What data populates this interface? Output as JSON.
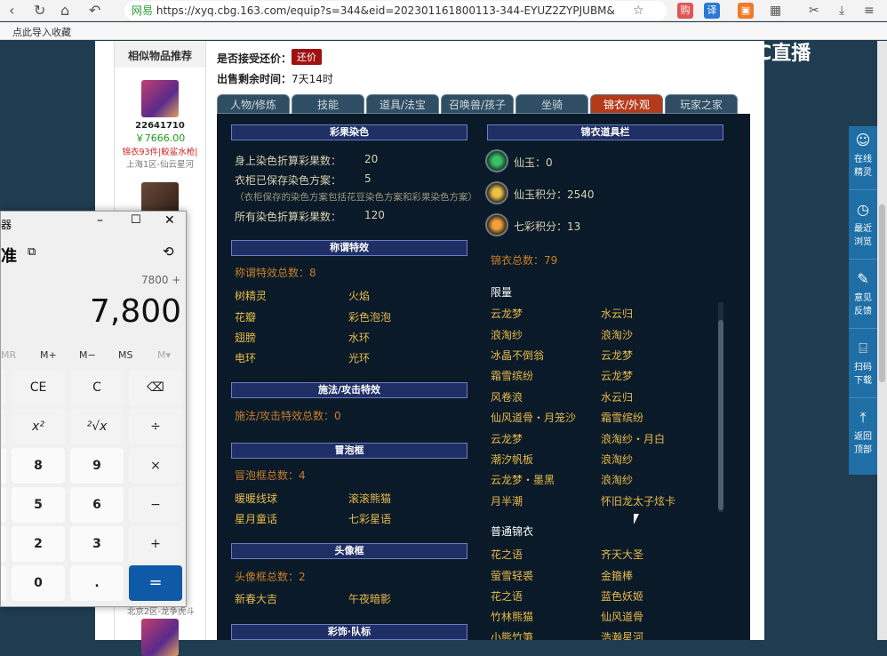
{
  "browser": {
    "security_label": "网易",
    "url": "https://xyq.cbg.163.com/equip?s=344&eid=202301161800113-344-EYUZ2ZYPJUBM&",
    "ext1": "购",
    "ext2": "译"
  },
  "bookmark_bar": {
    "import_label": "点此导入收藏"
  },
  "sidebar": {
    "title": "相似物品推荐",
    "items": [
      {
        "id": "22641710",
        "price": "￥7666.00",
        "tag": "锦衣93件|鲛鲨水枪|",
        "server": "上海1区-仙云星河"
      }
    ],
    "bottom_server": "北京2区-龙争虎斗"
  },
  "info": {
    "accept_label": "是否接受还价：",
    "accept_btn": "还价",
    "time_label": "出售剩余时间：",
    "time_value": "7天14时"
  },
  "tabs": [
    "人物/修炼",
    "技能",
    "道具/法宝",
    "召唤兽/孩子",
    "坐骑",
    "锦衣/外观",
    "玩家之家"
  ],
  "dye": {
    "title": "彩果染色",
    "row1_label": "身上染色折算彩果数：",
    "row1_value": "20",
    "row2_label": "衣柜已保存染色方案：",
    "row2_value": "5",
    "note": "（衣柜保存的染色方案包括花豆染色方案和彩果染色方案）",
    "row3_label": "所有染色折算彩果数：",
    "row3_value": "120"
  },
  "title_effect": {
    "title": "称谓特效",
    "total": "称谓特效总数：8",
    "items": [
      "树精灵",
      "火焰",
      "花瓣",
      "彩色泡泡",
      "翅膀",
      "水环",
      "电环",
      "光环"
    ]
  },
  "cast_effect": {
    "title": "施法/攻击特效",
    "total": "施法/攻击特效总数：0"
  },
  "bubble": {
    "title": "冒泡框",
    "total": "冒泡框总数：4",
    "items": [
      "暖暖线球",
      "滚滚熊猫",
      "星月童话",
      "七彩星语"
    ]
  },
  "avatar_frame": {
    "title": "头像框",
    "total": "头像框总数：2",
    "items": [
      "新春大吉",
      "午夜暗影"
    ]
  },
  "color_team": {
    "title": "彩饰·队标"
  },
  "wardrobe": {
    "title": "锦衣道具栏",
    "xianyu": "仙玉：0",
    "xianyu_points": "仙玉积分：2540",
    "qicai_points": "七彩积分：13",
    "total": "锦衣总数：79",
    "limited_title": "限量",
    "limited": [
      "云龙梦",
      "水云归",
      "浪淘纱",
      "浪淘沙",
      "冰晶不倒翁",
      "云龙梦",
      "霜雪缤纷",
      "云龙梦",
      "风卷浪",
      "水云归",
      "仙风道骨・月笼沙",
      "霜雪缤纷",
      "云龙梦",
      "浪淘纱・月白",
      "潮汐帆板",
      "浪淘纱",
      "云龙梦・墨黑",
      "浪淘纱",
      "月半潮",
      "怀旧龙太子炫卡"
    ],
    "common_title": "普通锦衣",
    "common": [
      "花之语",
      "齐天大圣",
      "萤雪轻裘",
      "金箍棒",
      "花之语",
      "蓝色妖姬",
      "竹林熊猫",
      "仙风道骨",
      "小熊竹笋",
      "浩瀚星河"
    ]
  },
  "calculator": {
    "title_frag": "器",
    "mode": "准",
    "history": "7800 +",
    "display": "7,800",
    "memory": [
      "MR",
      "M+",
      "M−",
      "MS",
      "M▾"
    ],
    "keys": [
      "CE",
      "C",
      "⌫",
      "x²",
      "²√x",
      "÷",
      "8",
      "9",
      "×",
      "5",
      "6",
      "−",
      "2",
      "3",
      "+",
      "0",
      ".",
      "="
    ]
  },
  "overlay": {
    "cc_logo": "CC直播"
  },
  "right_toolbar": [
    "在线\n精灵",
    "最近\n浏览",
    "意见\n反馈",
    "扫码\n下载",
    "返回\n顶部"
  ]
}
